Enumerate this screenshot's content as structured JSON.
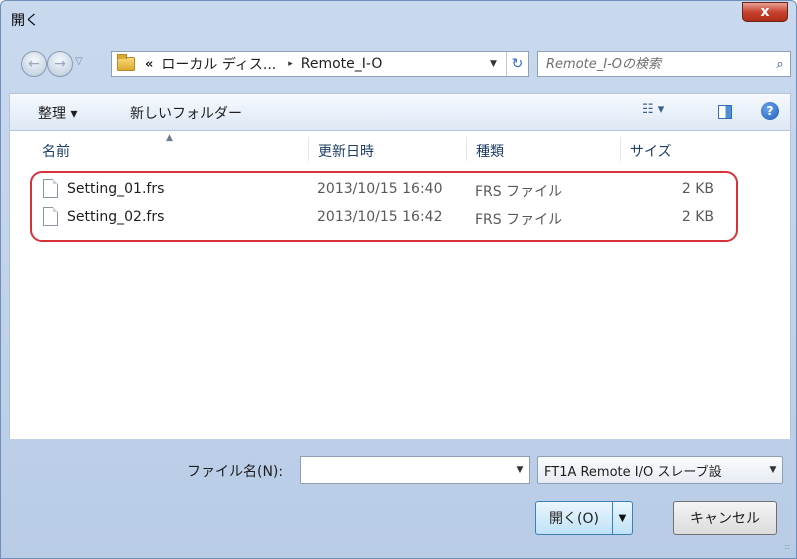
{
  "window": {
    "title": "開く",
    "close_glyph": "x"
  },
  "navigation": {
    "back_glyph": "←",
    "forward_glyph": "→",
    "history_glyph": "▽",
    "breadcrumb_overflow": "«",
    "breadcrumb": [
      "ローカル ディス...",
      "Remote_I-O"
    ],
    "breadcrumb_separator": "▸",
    "dropdown_glyph": "▼",
    "refresh_glyph": "↻",
    "search_placeholder": "Remote_I-Oの検索",
    "search_glyph": "⌕"
  },
  "toolbar": {
    "organize_label": "整理 ▾",
    "new_folder_label": "新しいフォルダー",
    "view_glyph": "☷ ▾",
    "help_glyph": "?"
  },
  "columns": {
    "name": "名前",
    "date": "更新日時",
    "type": "種類",
    "size": "サイズ",
    "sort_glyph": "▲"
  },
  "files": [
    {
      "name": "Setting_01.frs",
      "date": "2013/10/15 16:40",
      "type": "FRS ファイル",
      "size": "2 KB"
    },
    {
      "name": "Setting_02.frs",
      "date": "2013/10/15 16:42",
      "type": "FRS ファイル",
      "size": "2 KB"
    }
  ],
  "footer": {
    "filename_label": "ファイル名(N):",
    "filename_value": "",
    "filename_dropdown_glyph": "▼",
    "filetype_value": "FT1A Remote I/O スレーブ設",
    "filetype_dropdown_glyph": "▼",
    "open_label": "開く(O)",
    "open_split_glyph": "▼",
    "cancel_label": "キャンセル",
    "grip_glyph": ":::"
  },
  "colors": {
    "highlight": "#d7313a",
    "close_button": "#c7432f"
  }
}
